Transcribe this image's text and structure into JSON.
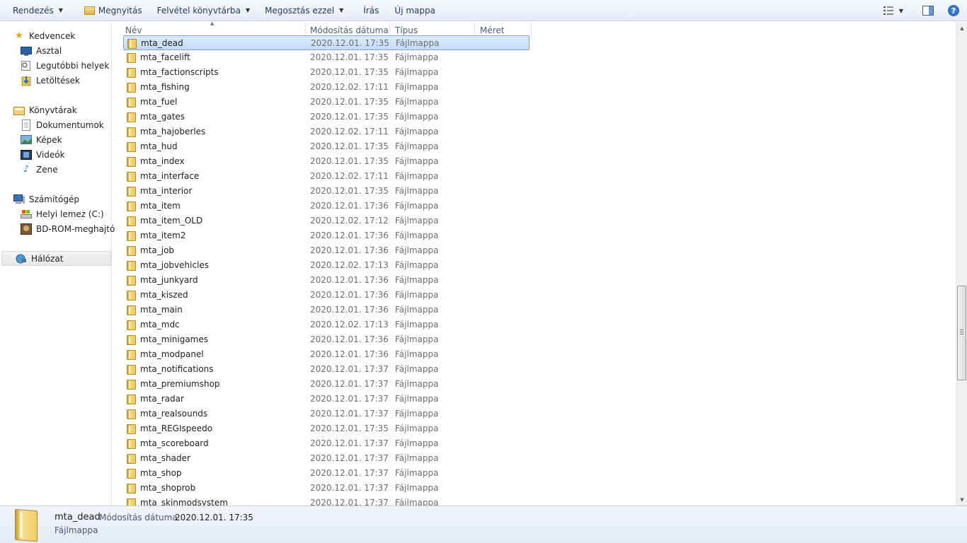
{
  "toolbar": {
    "organize": "Rendezés",
    "open": "Megnyitás",
    "include_library": "Felvétel könyvtárba",
    "share_with": "Megosztás ezzel",
    "burn": "Írás",
    "new_folder": "Új mappa",
    "help": "?"
  },
  "sidebar": {
    "favorites": "Kedvencek",
    "desktop": "Asztal",
    "recent": "Legutóbbi helyek",
    "downloads": "Letöltések",
    "libraries": "Könyvtárak",
    "documents": "Dokumentumok",
    "pictures": "Képek",
    "videos": "Videók",
    "music": "Zene",
    "computer": "Számítógép",
    "local_disk": "Helyi lemez (C:)",
    "bdrom": "BD-ROM-meghajtó",
    "network": "Hálózat"
  },
  "columns": {
    "name": "Név",
    "modified": "Módosítás dátuma",
    "type": "Típus",
    "size": "Méret"
  },
  "files": [
    {
      "name": "mta_dead",
      "date": "2020.12.01. 17:35",
      "type": "Fájlmappa"
    },
    {
      "name": "mta_facelift",
      "date": "2020.12.01. 17:35",
      "type": "Fájlmappa"
    },
    {
      "name": "mta_factionscripts",
      "date": "2020.12.01. 17:35",
      "type": "Fájlmappa"
    },
    {
      "name": "mta_fishing",
      "date": "2020.12.02. 17:11",
      "type": "Fájlmappa"
    },
    {
      "name": "mta_fuel",
      "date": "2020.12.01. 17:35",
      "type": "Fájlmappa"
    },
    {
      "name": "mta_gates",
      "date": "2020.12.01. 17:35",
      "type": "Fájlmappa"
    },
    {
      "name": "mta_hajoberles",
      "date": "2020.12.02. 17:11",
      "type": "Fájlmappa"
    },
    {
      "name": "mta_hud",
      "date": "2020.12.01. 17:35",
      "type": "Fájlmappa"
    },
    {
      "name": "mta_index",
      "date": "2020.12.01. 17:35",
      "type": "Fájlmappa"
    },
    {
      "name": "mta_interface",
      "date": "2020.12.02. 17:11",
      "type": "Fájlmappa"
    },
    {
      "name": "mta_interior",
      "date": "2020.12.01. 17:35",
      "type": "Fájlmappa"
    },
    {
      "name": "mta_item",
      "date": "2020.12.01. 17:36",
      "type": "Fájlmappa"
    },
    {
      "name": "mta_item_OLD",
      "date": "2020.12.02. 17:12",
      "type": "Fájlmappa"
    },
    {
      "name": "mta_item2",
      "date": "2020.12.01. 17:36",
      "type": "Fájlmappa"
    },
    {
      "name": "mta_job",
      "date": "2020.12.01. 17:36",
      "type": "Fájlmappa"
    },
    {
      "name": "mta_jobvehicles",
      "date": "2020.12.02. 17:13",
      "type": "Fájlmappa"
    },
    {
      "name": "mta_junkyard",
      "date": "2020.12.01. 17:36",
      "type": "Fájlmappa"
    },
    {
      "name": "mta_kiszed",
      "date": "2020.12.01. 17:36",
      "type": "Fájlmappa"
    },
    {
      "name": "mta_main",
      "date": "2020.12.01. 17:36",
      "type": "Fájlmappa"
    },
    {
      "name": "mta_mdc",
      "date": "2020.12.02. 17:13",
      "type": "Fájlmappa"
    },
    {
      "name": "mta_minigames",
      "date": "2020.12.01. 17:36",
      "type": "Fájlmappa"
    },
    {
      "name": "mta_modpanel",
      "date": "2020.12.01. 17:36",
      "type": "Fájlmappa"
    },
    {
      "name": "mta_notifications",
      "date": "2020.12.01. 17:37",
      "type": "Fájlmappa"
    },
    {
      "name": "mta_premiumshop",
      "date": "2020.12.01. 17:37",
      "type": "Fájlmappa"
    },
    {
      "name": "mta_radar",
      "date": "2020.12.01. 17:37",
      "type": "Fájlmappa"
    },
    {
      "name": "mta_realsounds",
      "date": "2020.12.01. 17:37",
      "type": "Fájlmappa"
    },
    {
      "name": "mta_REGIspeedo",
      "date": "2020.12.01. 17:35",
      "type": "Fájlmappa"
    },
    {
      "name": "mta_scoreboard",
      "date": "2020.12.01. 17:37",
      "type": "Fájlmappa"
    },
    {
      "name": "mta_shader",
      "date": "2020.12.01. 17:37",
      "type": "Fájlmappa"
    },
    {
      "name": "mta_shop",
      "date": "2020.12.01. 17:37",
      "type": "Fájlmappa"
    },
    {
      "name": "mta_shoprob",
      "date": "2020.12.01. 17:37",
      "type": "Fájlmappa"
    },
    {
      "name": "mta_skinmodsystem",
      "date": "2020.12.01. 17:37",
      "type": "Fájlmappa"
    }
  ],
  "details": {
    "name": "mta_dead",
    "modified_label": "Módosítás dátuma:",
    "modified_value": "2020.12.01. 17:35",
    "type": "Fájlmappa"
  },
  "colors": {
    "selection": "#c1dcfc",
    "toolbar_text": "#1e395b",
    "header_text": "#4c607a"
  }
}
